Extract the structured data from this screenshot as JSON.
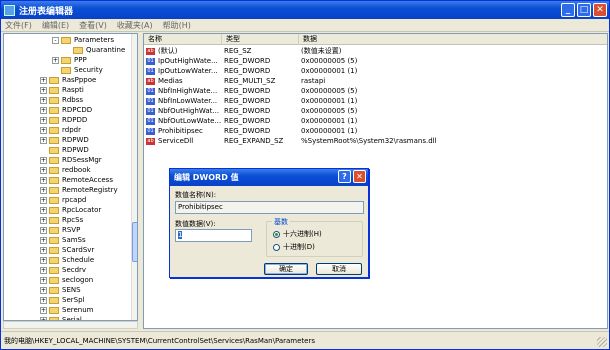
{
  "window": {
    "title": "注册表编辑器"
  },
  "menu": [
    "文件(F)",
    "编辑(E)",
    "查看(V)",
    "收藏夹(A)",
    "帮助(H)"
  ],
  "tree": {
    "items": [
      {
        "label": "Parameters",
        "indent": 48,
        "expand": "-"
      },
      {
        "label": "Quarantine",
        "indent": 60,
        "expand": ""
      },
      {
        "label": "PPP",
        "indent": 48,
        "expand": "+"
      },
      {
        "label": "Security",
        "indent": 48,
        "expand": ""
      },
      {
        "label": "RasPppoe",
        "indent": 36,
        "expand": "+"
      },
      {
        "label": "Raspti",
        "indent": 36,
        "expand": "+"
      },
      {
        "label": "Rdbss",
        "indent": 36,
        "expand": "+"
      },
      {
        "label": "RDPCDD",
        "indent": 36,
        "expand": "+"
      },
      {
        "label": "RDPDD",
        "indent": 36,
        "expand": "+"
      },
      {
        "label": "rdpdr",
        "indent": 36,
        "expand": "+"
      },
      {
        "label": "RDPWD",
        "indent": 36,
        "expand": "+"
      },
      {
        "label": "RDPWD",
        "indent": 36,
        "expand": ""
      },
      {
        "label": "RDSessMgr",
        "indent": 36,
        "expand": "+"
      },
      {
        "label": "redbook",
        "indent": 36,
        "expand": "+"
      },
      {
        "label": "RemoteAccess",
        "indent": 36,
        "expand": "+"
      },
      {
        "label": "RemoteRegistry",
        "indent": 36,
        "expand": "+"
      },
      {
        "label": "rpcapd",
        "indent": 36,
        "expand": "+"
      },
      {
        "label": "RpcLocator",
        "indent": 36,
        "expand": "+"
      },
      {
        "label": "RpcSs",
        "indent": 36,
        "expand": "+"
      },
      {
        "label": "RSVP",
        "indent": 36,
        "expand": "+"
      },
      {
        "label": "SamSs",
        "indent": 36,
        "expand": "+"
      },
      {
        "label": "SCardSvr",
        "indent": 36,
        "expand": "+"
      },
      {
        "label": "Schedule",
        "indent": 36,
        "expand": "+"
      },
      {
        "label": "Secdrv",
        "indent": 36,
        "expand": "+"
      },
      {
        "label": "seclogon",
        "indent": 36,
        "expand": "+"
      },
      {
        "label": "SENS",
        "indent": 36,
        "expand": "+"
      },
      {
        "label": "SerSpl",
        "indent": 36,
        "expand": "+"
      },
      {
        "label": "Serenum",
        "indent": 36,
        "expand": "+"
      },
      {
        "label": "Serial",
        "indent": 36,
        "expand": "+"
      }
    ]
  },
  "list": {
    "headers": [
      "名称",
      "类型",
      "数据"
    ],
    "rows": [
      {
        "icon": "ab",
        "name": "(默认)",
        "type": "REG_SZ",
        "data": "(数值未设置)"
      },
      {
        "icon": "bin",
        "name": "IpOutHighWate...",
        "type": "REG_DWORD",
        "data": "0x00000005 (5)"
      },
      {
        "icon": "bin",
        "name": "IpOutLowWater...",
        "type": "REG_DWORD",
        "data": "0x00000001 (1)"
      },
      {
        "icon": "ab",
        "name": "Medias",
        "type": "REG_MULTI_SZ",
        "data": "rastapi"
      },
      {
        "icon": "bin",
        "name": "NbfInHighWate...",
        "type": "REG_DWORD",
        "data": "0x00000005 (5)"
      },
      {
        "icon": "bin",
        "name": "NbfInLowWater...",
        "type": "REG_DWORD",
        "data": "0x00000001 (1)"
      },
      {
        "icon": "bin",
        "name": "NbfOutHighWat...",
        "type": "REG_DWORD",
        "data": "0x00000005 (5)"
      },
      {
        "icon": "bin",
        "name": "NbfOutLowWate...",
        "type": "REG_DWORD",
        "data": "0x00000001 (1)"
      },
      {
        "icon": "bin",
        "name": "Prohibitipsec",
        "type": "REG_DWORD",
        "data": "0x00000001 (1)"
      },
      {
        "icon": "ab",
        "name": "ServiceDll",
        "type": "REG_EXPAND_SZ",
        "data": "%SystemRoot%\\System32\\rasmans.dll"
      }
    ]
  },
  "status": "我的电脑\\HKEY_LOCAL_MACHINE\\SYSTEM\\CurrentControlSet\\Services\\RasMan\\Parameters",
  "dialog": {
    "title": "编辑 DWORD 值",
    "help": "?",
    "close": "✕",
    "name_label": "数值名称(N):",
    "name_value": "Prohibitipsec",
    "data_label": "数值数据(V):",
    "data_value": "1",
    "base_label": "基数",
    "hex_label": "十六进制(H)",
    "dec_label": "十进制(D)",
    "ok": "确定",
    "cancel": "取消"
  },
  "title_buttons": {
    "min": "_",
    "max": "□",
    "close": "✕"
  }
}
